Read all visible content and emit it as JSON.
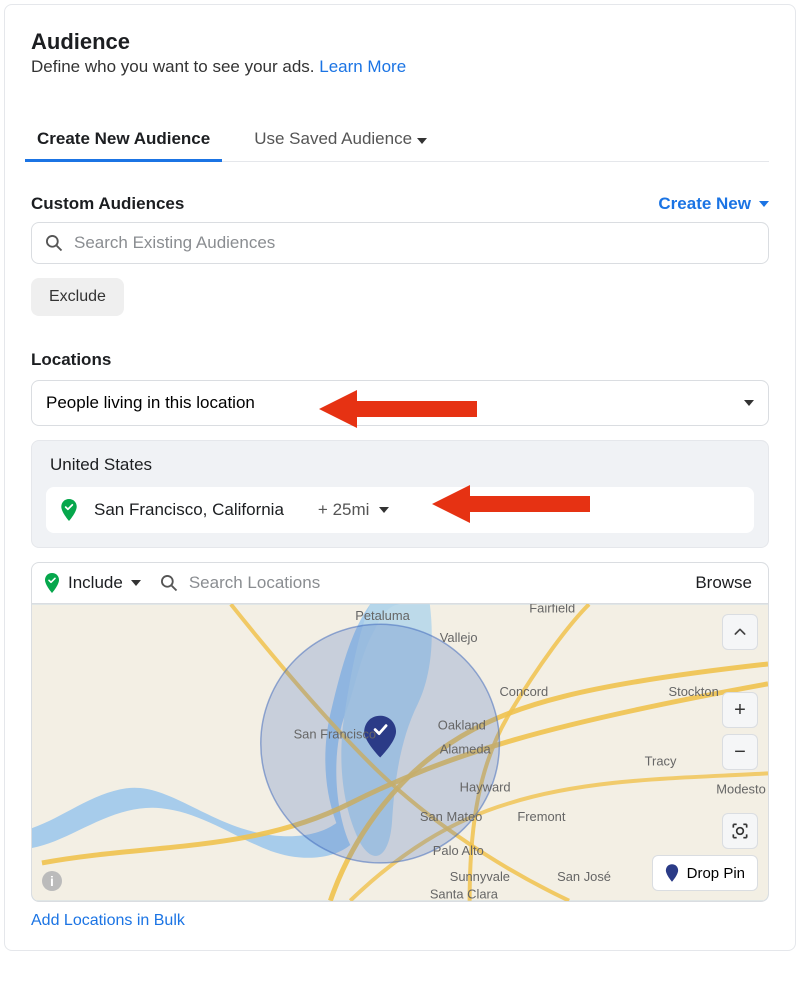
{
  "header": {
    "title": "Audience",
    "subtitle": "Define who you want to see your ads.",
    "learn_more": "Learn More"
  },
  "tabs": {
    "create_new": "Create New Audience",
    "use_saved": "Use Saved Audience"
  },
  "custom_audiences": {
    "label": "Custom Audiences",
    "create_new": "Create New",
    "search_placeholder": "Search Existing Audiences",
    "exclude": "Exclude"
  },
  "locations": {
    "label": "Locations",
    "dropdown_value": "People living in this location",
    "country": "United States",
    "city": "San Francisco, California",
    "radius": "+ 25mi",
    "include_label": "Include",
    "search_placeholder": "Search Locations",
    "browse": "Browse",
    "drop_pin": "Drop Pin",
    "bulk_link": "Add Locations in Bulk"
  },
  "map": {
    "city_labels": [
      "Petaluma",
      "Fairfield",
      "Vallejo",
      "Concord",
      "Stockton",
      "San Francisco",
      "Oakland",
      "Alameda",
      "Hayward",
      "Tracy",
      "Modesto",
      "San Mateo",
      "Fremont",
      "Palo Alto",
      "Sunnyvale",
      "San José",
      "Santa Clara"
    ]
  }
}
